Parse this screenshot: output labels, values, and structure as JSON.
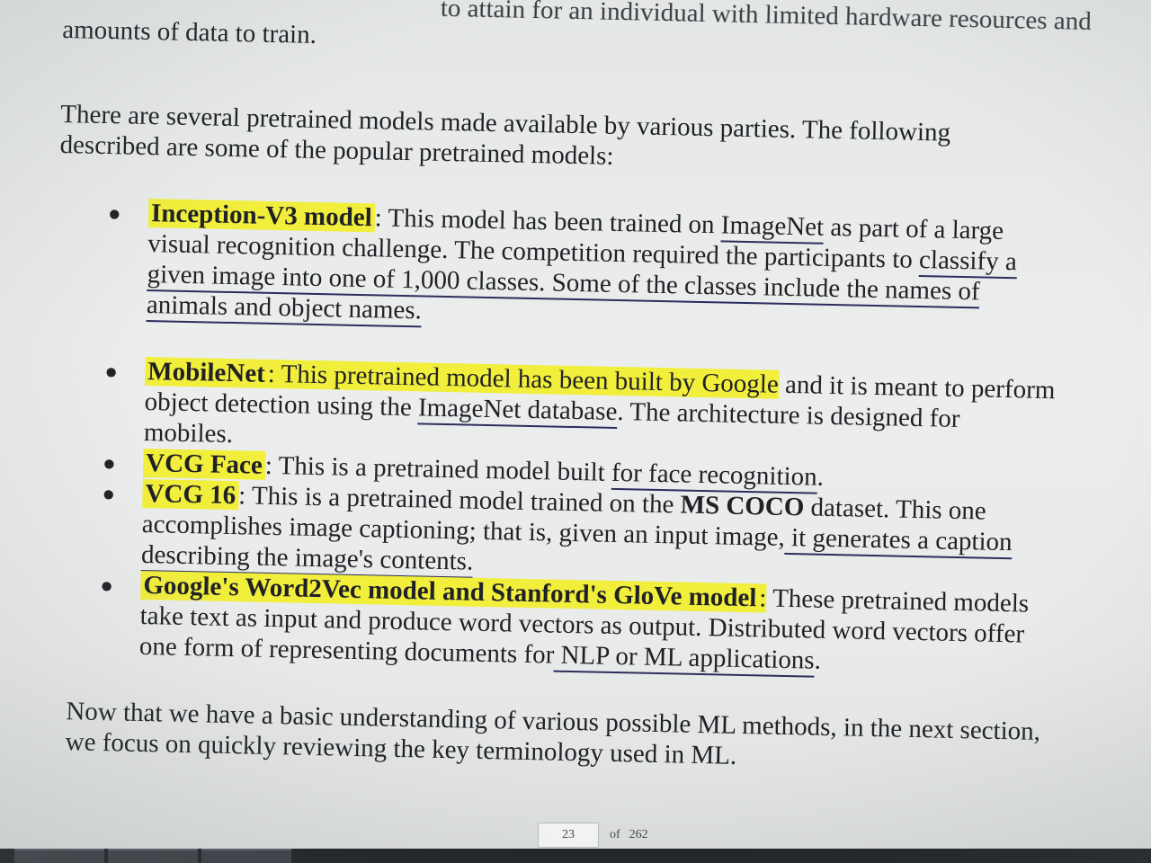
{
  "document": {
    "top_partial": "amounts of data to train.",
    "top_cut": "to attain for an individual with limited hardware resources and",
    "intro_lines": [
      "There are several pretrained models made available by various parties. The following",
      "described are some of the popular pretrained models:"
    ],
    "items": [
      {
        "term": "Inception-V3 model",
        "colon": ":",
        "line1_a": " This model has been trained on ",
        "line1_link": "ImageNet",
        "line1_b": " as part of a large",
        "line2_a": "visual recognition challenge. The competition required the participants to ",
        "line2_ul": "classify a",
        "line3": "given image into one of 1,000 classes. Some of the classes include the names of",
        "line4": "animals and object names."
      },
      {
        "term": "MobileNet",
        "colon": ":",
        "line1_hl": " This pretrained model has been built by Google",
        "line1_b": " and it is meant to perform",
        "line2_a": "object detection using the ",
        "line2_ul": "ImageNet database",
        "line2_b": ". The architecture is designed for",
        "line3": "mobiles."
      },
      {
        "term": "VCG Face",
        "colon": ":",
        "line1_a": " This is a pretrained model built ",
        "line1_ul": "for face recognition",
        "line1_b": "."
      },
      {
        "term": "VCG 16",
        "colon": ":",
        "line1_a": " This is a pretrained model trained on the ",
        "line1_bold": "MS COCO",
        "line1_b": " dataset. This one",
        "line2_a": "accomplishes image captioning; that is, given an input image,",
        "line2_ul": " it generates a caption",
        "line3_ul": "describing the image's contents."
      },
      {
        "term": "Google's Word2Vec model and Stanford's GloVe model",
        "colon": ":",
        "line1_b": " These pretrained models",
        "line2": "take text as input and produce word vectors as output. Distributed word vectors offer",
        "line3_a": "one form of representing documents for",
        "line3_ul": " NLP or ML applications",
        "line3_b": "."
      }
    ],
    "outro_lines": [
      "Now that we have a basic understanding of various possible ML methods, in the next section,",
      "we focus on quickly reviewing the key terminology used in ML."
    ]
  },
  "pager": {
    "current_page": "23",
    "of_label": "of",
    "total_pages": "262"
  },
  "colors": {
    "highlight": "#f1ee3c",
    "underline": "#2b2d5e",
    "text": "#1f2126"
  }
}
